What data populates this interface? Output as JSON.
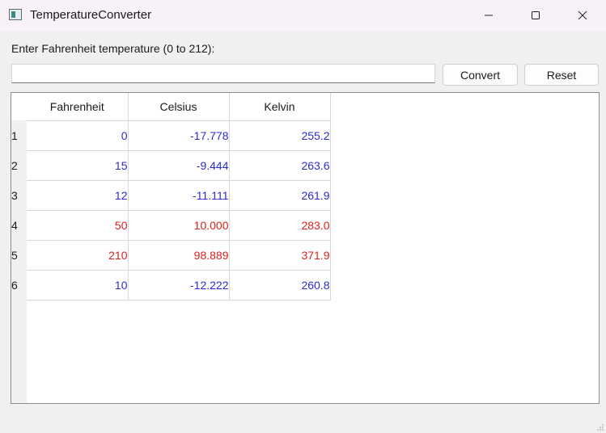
{
  "window": {
    "title": "TemperatureConverter"
  },
  "form": {
    "prompt": "Enter Fahrenheit temperature (0 to 212):",
    "input_value": "",
    "convert_label": "Convert",
    "reset_label": "Reset"
  },
  "table": {
    "columns": [
      "Fahrenheit",
      "Celsius",
      "Kelvin"
    ],
    "rows": [
      {
        "index": "1",
        "fahrenheit": "0",
        "celsius": "-17.778",
        "kelvin": "255.2",
        "color": "#2b2bd6"
      },
      {
        "index": "2",
        "fahrenheit": "15",
        "celsius": "-9.444",
        "kelvin": "263.6",
        "color": "#2b2bd6"
      },
      {
        "index": "3",
        "fahrenheit": "12",
        "celsius": "-11.111",
        "kelvin": "261.9",
        "color": "#2b2bd6"
      },
      {
        "index": "4",
        "fahrenheit": "50",
        "celsius": "10.000",
        "kelvin": "283.0",
        "color": "#e0201c"
      },
      {
        "index": "5",
        "fahrenheit": "210",
        "celsius": "98.889",
        "kelvin": "371.9",
        "color": "#e0201c"
      },
      {
        "index": "6",
        "fahrenheit": "10",
        "celsius": "-12.222",
        "kelvin": "260.8",
        "color": "#2b2bd6"
      }
    ]
  },
  "icons": {
    "app": "app-window-icon",
    "minimize": "minimize-icon",
    "maximize": "maximize-icon",
    "close": "close-icon",
    "grip": "resize-grip-icon"
  }
}
